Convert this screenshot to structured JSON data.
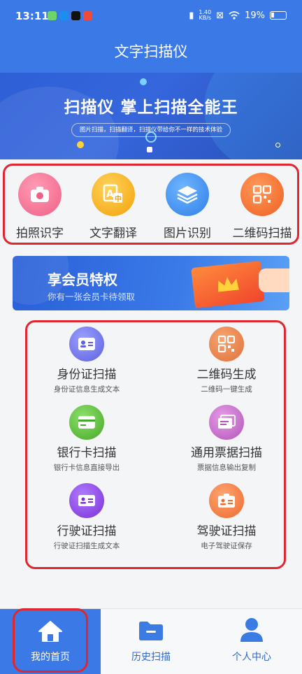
{
  "status_bar": {
    "time": "13:11",
    "net_speed_value": "1.40",
    "net_speed_unit": "KB/s",
    "battery": "19%"
  },
  "header": {
    "title": "文字扫描仪"
  },
  "banner": {
    "headline": "扫描仪 掌上扫描全能王",
    "subtitle": "图片扫描，扫描翻译，扫描仪带给你不一样的技术体验"
  },
  "quick_tools": [
    {
      "label": "拍照识字",
      "icon": "camera-icon",
      "color": "#f06a8e"
    },
    {
      "label": "文字翻译",
      "icon": "translate-icon",
      "color": "#f5a70c"
    },
    {
      "label": "图片识别",
      "icon": "layers-icon",
      "color": "#3a8bf0"
    },
    {
      "label": "二维码扫描",
      "icon": "qrcode-icon",
      "color": "#f26a2e"
    }
  ],
  "vip": {
    "title": "享会员特权",
    "subtitle": "你有一张会员卡待领取"
  },
  "scan_items": [
    {
      "name": "身份证扫描",
      "desc": "身份证信息生成文本",
      "icon": "id-card-icon",
      "color": "#6a6ee8"
    },
    {
      "name": "二维码生成",
      "desc": "二维码一键生成",
      "icon": "qrcode-icon",
      "color": "#e8804a"
    },
    {
      "name": "银行卡扫描",
      "desc": "银行卡信息直接导出",
      "icon": "bank-card-icon",
      "color": "#5dbb3a"
    },
    {
      "name": "通用票据扫描",
      "desc": "票据信息输出复制",
      "icon": "receipt-icon",
      "color": "#c267c9"
    },
    {
      "name": "行驶证扫描",
      "desc": "行驶证扫描生成文本",
      "icon": "vehicle-license-icon",
      "color": "#8a3ee0"
    },
    {
      "name": "驾驶证扫描",
      "desc": "电子驾驶证保存",
      "icon": "driver-license-icon",
      "color": "#f27a3a"
    }
  ],
  "bottom_nav": [
    {
      "label": "我的首页",
      "icon": "home-icon",
      "active": true
    },
    {
      "label": "历史扫描",
      "icon": "folder-icon",
      "active": false
    },
    {
      "label": "个人中心",
      "icon": "user-icon",
      "active": false
    }
  ],
  "colors": {
    "primary": "#3b7ae6",
    "highlight_border": "#e0262f"
  }
}
